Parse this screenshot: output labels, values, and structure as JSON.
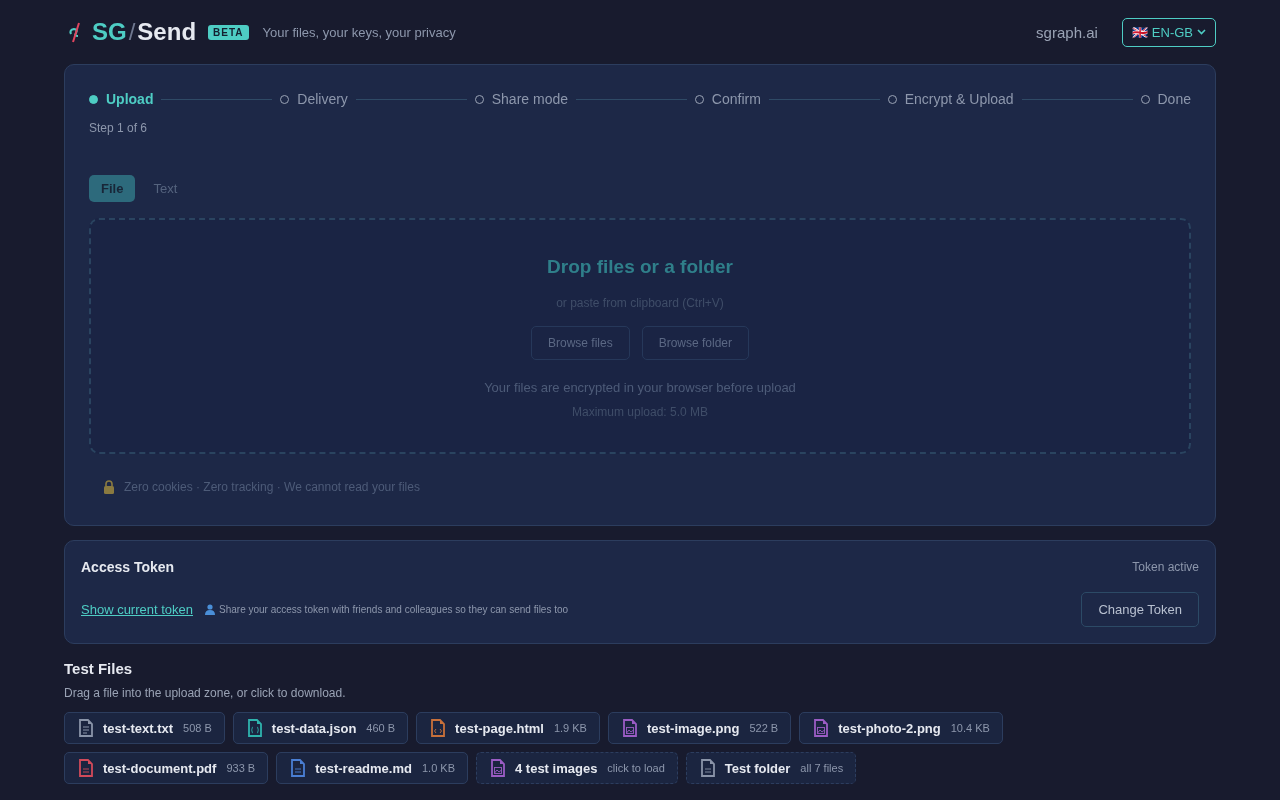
{
  "header": {
    "logo_prefix": "SG",
    "logo_slash": "/",
    "logo_suffix": "Send",
    "badge": "BETA",
    "tagline": "Your files, your keys, your privacy",
    "site_link": "sgraph.ai",
    "language": {
      "flag": "🇬🇧",
      "label": "EN-GB"
    }
  },
  "steps": [
    {
      "label": "Upload",
      "selected": true
    },
    {
      "label": "Delivery",
      "selected": false
    },
    {
      "label": "Share mode",
      "selected": false
    },
    {
      "label": "Confirm",
      "selected": false
    },
    {
      "label": "Encrypt & Upload",
      "selected": false
    },
    {
      "label": "Done",
      "selected": false
    }
  ],
  "step_counter": "Step 1 of 6",
  "tabs": [
    {
      "label": "File",
      "selected": true
    },
    {
      "label": "Text",
      "selected": false
    }
  ],
  "drop_zone": {
    "title": "Drop files or a folder",
    "subtitle": "or paste from clipboard (Ctrl+V)",
    "buttons": [
      "Browse files",
      "Browse folder"
    ],
    "note": "Your files are encrypted in your browser before upload",
    "limit": "Maximum upload: 5.0 MB"
  },
  "privacy_note": "Zero cookies · Zero tracking · We cannot read your files",
  "access_token": {
    "title": "Access Token",
    "status": "Token active",
    "show_link": "Show current token",
    "share_note": "Share your access token with friends and colleagues so they can send files too",
    "change_button": "Change Token"
  },
  "test_files": {
    "title": "Test Files",
    "subtitle": "Drag a file into the upload zone, or click to download.",
    "items": [
      {
        "kind": "text",
        "color": "#8a94a8",
        "name": "test-text.txt",
        "size": "508 B"
      },
      {
        "kind": "json",
        "color": "#2fb3ad",
        "name": "test-data.json",
        "size": "460 B"
      },
      {
        "kind": "html",
        "color": "#c8703a",
        "name": "test-page.html",
        "size": "1.9 KB"
      },
      {
        "kind": "image",
        "color": "#9b5cc4",
        "name": "test-image.png",
        "size": "522 B"
      },
      {
        "kind": "image",
        "color": "#9b5cc4",
        "name": "test-photo-2.png",
        "size": "10.4 KB"
      },
      {
        "kind": "pdf",
        "color": "#d24a5a",
        "name": "test-document.pdf",
        "size": "933 B"
      },
      {
        "kind": "markdown",
        "color": "#4a7fd4",
        "name": "test-readme.md",
        "size": "1.0 KB"
      },
      {
        "kind": "image-set",
        "color": "#9b5cc4",
        "name": "4 test images",
        "size": "click to load"
      },
      {
        "kind": "folder",
        "color": "#8a94a8",
        "name": "Test folder",
        "size": "all 7 files"
      }
    ]
  }
}
